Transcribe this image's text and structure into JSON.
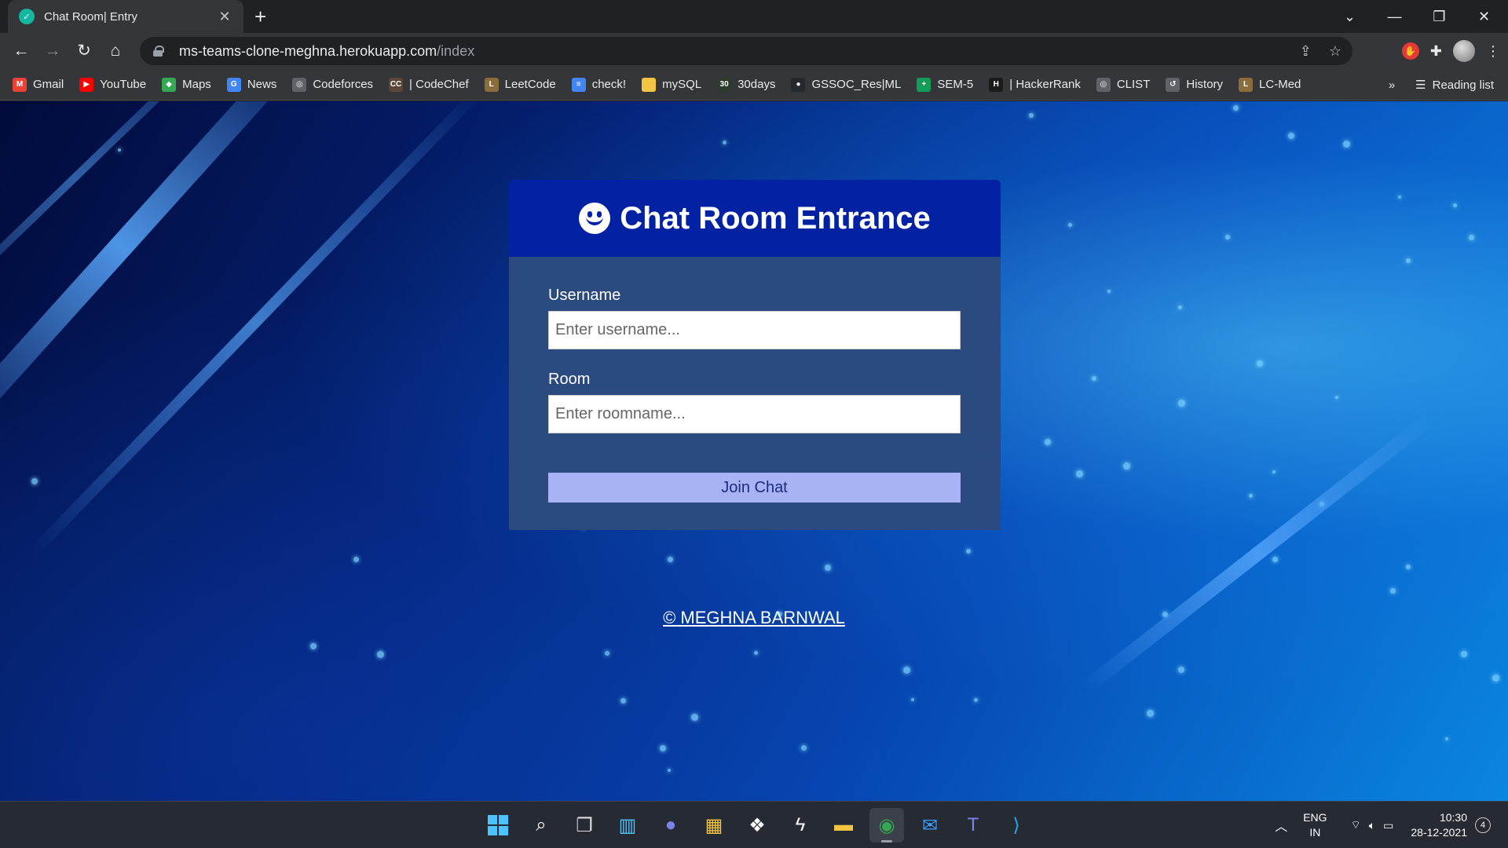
{
  "browser": {
    "tab": {
      "title": "Chat Room| Entry",
      "favicon_icon": "chat-app-icon"
    },
    "url": {
      "host": "ms-teams-clone-meghna.herokuapp.com",
      "path": "/index"
    },
    "bookmarks": [
      {
        "label": "Gmail",
        "icon": "gmail-icon",
        "color": "#ea4335",
        "glyph": "M"
      },
      {
        "label": "YouTube",
        "icon": "youtube-icon",
        "color": "#ff0000",
        "glyph": "▶"
      },
      {
        "label": "Maps",
        "icon": "maps-icon",
        "color": "#34a853",
        "glyph": "◆"
      },
      {
        "label": "News",
        "icon": "news-icon",
        "color": "#4285f4",
        "glyph": "G"
      },
      {
        "label": "Codeforces",
        "icon": "globe-icon",
        "color": "#5f6368",
        "glyph": "◎"
      },
      {
        "label": "| CodeChef",
        "icon": "codechef-icon",
        "color": "#5b4638",
        "glyph": "CC"
      },
      {
        "label": "LeetCode",
        "icon": "leetcode-icon",
        "color": "#8a6d3b",
        "glyph": "L"
      },
      {
        "label": "check!",
        "icon": "docs-icon",
        "color": "#4285f4",
        "glyph": "≡"
      },
      {
        "label": "mySQL",
        "icon": "folder-icon",
        "color": "#f4c542",
        "glyph": ""
      },
      {
        "label": "30days",
        "icon": "30days-icon",
        "color": "#2d3b2d",
        "glyph": "30"
      },
      {
        "label": "GSSOC_Res|ML",
        "icon": "github-icon",
        "color": "#24292e",
        "glyph": "●"
      },
      {
        "label": "SEM-5",
        "icon": "sheets-icon",
        "color": "#0f9d58",
        "glyph": "+"
      },
      {
        "label": "| HackerRank",
        "icon": "hackerrank-icon",
        "color": "#1a1a1a",
        "glyph": "H"
      },
      {
        "label": "CLIST",
        "icon": "globe-icon",
        "color": "#5f6368",
        "glyph": "◎"
      },
      {
        "label": "History",
        "icon": "history-icon",
        "color": "#5f6368",
        "glyph": "↺"
      },
      {
        "label": "LC-Med",
        "icon": "leetcode-icon",
        "color": "#8a6d3b",
        "glyph": "L"
      }
    ],
    "reading_list": "Reading list",
    "more_chevron": "»"
  },
  "page": {
    "card_title": "Chat Room Entrance",
    "username_label": "Username",
    "username_placeholder": "Enter username...",
    "room_label": "Room",
    "room_placeholder": "Enter roomname...",
    "join_label": "Join Chat",
    "footer": "© MEGHNA BARNWAL"
  },
  "colors": {
    "card_header": "#0322a3",
    "card_body": "#2b4a80",
    "join_button": "#a8b3f5"
  },
  "taskbar": {
    "apps": [
      "start-icon",
      "search-icon",
      "task-view-icon",
      "widgets-icon",
      "chat-icon",
      "store-icon",
      "dropbox-icon",
      "bolt-app-icon",
      "file-explorer-icon",
      "chrome-icon",
      "mail-icon",
      "teams-icon",
      "vscode-icon"
    ],
    "lang_top": "ENG",
    "lang_bottom": "IN",
    "time": "10:30",
    "date": "28-12-2021",
    "notifications": "4"
  }
}
